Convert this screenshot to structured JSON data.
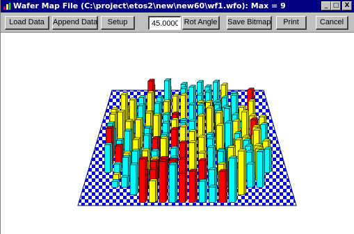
{
  "window": {
    "title": "Wafer Map File (C:\\project\\etos2\\new\\new60\\wf1.wfo): Max = 9",
    "minimize_glyph": "_",
    "maximize_glyph": "□",
    "close_glyph": "X"
  },
  "toolbar": {
    "load_data": "Load Data",
    "append_data": "Append Data",
    "setup": "Setup",
    "angle_value": "45.00000",
    "rot_angle": "Rot Angle",
    "save_bitmap": "Save Bitmap",
    "print": "Print",
    "cancel": "Cancel"
  },
  "wafer_map": {
    "max_value": 9,
    "rotation_deg": 45,
    "colors": {
      "checker_blue": "#0000ff",
      "checker_white": "#ffffff",
      "bar_cyan": "#00ffff",
      "bar_yellow": "#ffff00",
      "bar_red": "#ff0000",
      "outline": "#000000"
    }
  },
  "icons": {
    "app": "wafer-map-app-icon",
    "minimize": "minimize-icon",
    "maximize": "maximize-icon",
    "close": "close-icon"
  }
}
